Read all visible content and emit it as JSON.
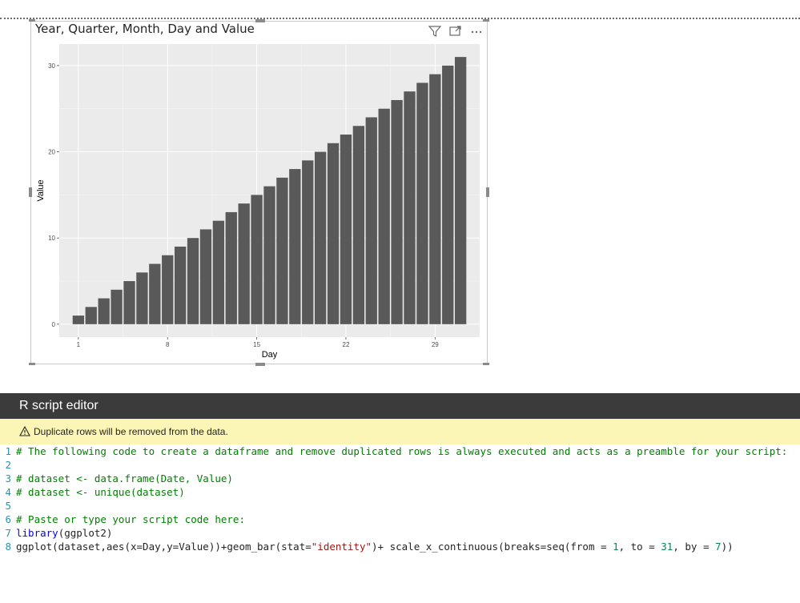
{
  "visual": {
    "title": "Year, Quarter, Month, Day and Value",
    "icons": [
      "filter-icon",
      "focus-mode-icon",
      "more-options-icon"
    ]
  },
  "chart_data": {
    "type": "bar",
    "x": [
      1,
      2,
      3,
      4,
      5,
      6,
      7,
      8,
      9,
      10,
      11,
      12,
      13,
      14,
      15,
      16,
      17,
      18,
      19,
      20,
      21,
      22,
      23,
      24,
      25,
      26,
      27,
      28,
      29,
      30,
      31
    ],
    "values": [
      1,
      2,
      3,
      4,
      5,
      6,
      7,
      8,
      9,
      10,
      11,
      12,
      13,
      14,
      15,
      16,
      17,
      18,
      19,
      20,
      21,
      22,
      23,
      24,
      25,
      26,
      27,
      28,
      29,
      30,
      31
    ],
    "xticks": [
      1,
      8,
      15,
      22,
      29
    ],
    "yticks": [
      0,
      10,
      20,
      30
    ],
    "xlabel": "Day",
    "ylabel": "Value",
    "xlim": [
      -0.5,
      32.5
    ],
    "ylim": [
      -1.5,
      32.5
    ],
    "grid": true,
    "bar_color": "#595959",
    "panel_color": "#ebebeb"
  },
  "editor": {
    "title": "R script editor",
    "warning": "Duplicate rows will be removed from the data.",
    "lines": [
      {
        "num": "1",
        "parts": [
          {
            "t": "# The following code to create a dataframe and remove duplicated rows is always executed and acts as a preamble for your script:",
            "c": "comment"
          }
        ]
      },
      {
        "num": "2",
        "parts": []
      },
      {
        "num": "3",
        "parts": [
          {
            "t": "# dataset <- data.frame(Date, Value)",
            "c": "comment"
          }
        ]
      },
      {
        "num": "4",
        "parts": [
          {
            "t": "# dataset <- unique(dataset)",
            "c": "comment"
          }
        ]
      },
      {
        "num": "5",
        "parts": []
      },
      {
        "num": "6",
        "parts": [
          {
            "t": "# Paste or type your script code here:",
            "c": "comment"
          }
        ]
      },
      {
        "num": "7",
        "parts": [
          {
            "t": "library",
            "c": "keyword"
          },
          {
            "t": "(ggplot2)",
            "c": "plain"
          }
        ]
      },
      {
        "num": "8",
        "parts": [
          {
            "t": "ggplot(dataset,aes(x=Day,y=Value))+geom_bar(stat=",
            "c": "plain"
          },
          {
            "t": "\"identity\"",
            "c": "string"
          },
          {
            "t": ")+ scale_x_continuous(breaks=seq(from = ",
            "c": "plain"
          },
          {
            "t": "1",
            "c": "number"
          },
          {
            "t": ", to = ",
            "c": "plain"
          },
          {
            "t": "31",
            "c": "number"
          },
          {
            "t": ", by = ",
            "c": "plain"
          },
          {
            "t": "7",
            "c": "number"
          },
          {
            "t": "))",
            "c": "plain"
          }
        ]
      }
    ]
  }
}
